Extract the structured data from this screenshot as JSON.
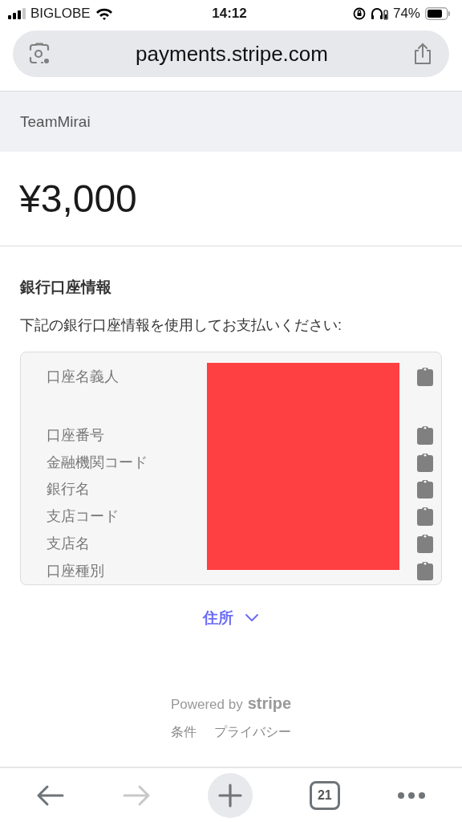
{
  "status_bar": {
    "carrier": "BIGLOBE",
    "time": "14:12",
    "battery": "74%"
  },
  "browser": {
    "url": "payments.stripe.com",
    "tab_count": "21",
    "forward_disabled": true
  },
  "merchant": "TeamMirai",
  "amount": "¥3,000",
  "section": {
    "title": "銀行口座情報",
    "instruction": "下記の銀行口座情報を使用してお支払いください:"
  },
  "fields": [
    {
      "label": "口座名義人",
      "tall": true
    },
    {
      "label": "口座番号",
      "tall": false
    },
    {
      "label": "金融機関コード",
      "tall": false
    },
    {
      "label": "銀行名",
      "tall": false
    },
    {
      "label": "支店コード",
      "tall": false
    },
    {
      "label": "支店名",
      "tall": false
    },
    {
      "label": "口座種別",
      "tall": false
    }
  ],
  "address_toggle": {
    "label": "住所",
    "expanded": false
  },
  "footer": {
    "powered_by": "Powered by",
    "brand": "stripe",
    "links": [
      "条件",
      "プライバシー"
    ]
  }
}
